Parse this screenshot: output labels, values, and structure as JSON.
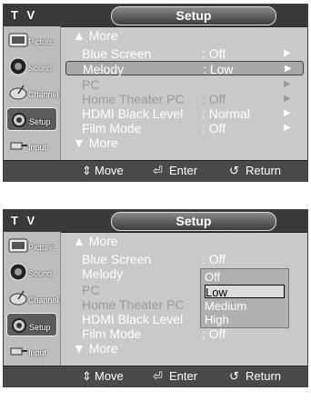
{
  "menu": {
    "tv_label": "T V",
    "title": "Setup",
    "nav": [
      {
        "label": "Picture"
      },
      {
        "label": "Sound"
      },
      {
        "label": "Channel"
      },
      {
        "label": "Setup"
      },
      {
        "label": "Input"
      }
    ],
    "more_up": "More",
    "more_down": "More",
    "footer": {
      "move": "Move",
      "enter": "Enter",
      "return": "Return"
    }
  },
  "screen1": {
    "rows": [
      {
        "label": "Blue Screen",
        "value": ": Off"
      },
      {
        "label": "Melody",
        "value": ": Low"
      },
      {
        "label": "PC",
        "value": ""
      },
      {
        "label": "Home Theater PC",
        "value": ": Off"
      },
      {
        "label": "HDMI Black Level",
        "value": ": Normal"
      },
      {
        "label": "Film Mode",
        "value": ": Off"
      }
    ]
  },
  "screen2": {
    "rows": [
      {
        "label": "Blue Screen",
        "value": ": Off"
      },
      {
        "label": "Melody",
        "value": ""
      },
      {
        "label": "PC",
        "value": ""
      },
      {
        "label": "Home Theater PC",
        "value": ""
      },
      {
        "label": "HDMI Black Level",
        "value": ""
      },
      {
        "label": "Film Mode",
        "value": ": Off"
      }
    ],
    "dropdown": [
      "Off",
      "Low",
      "Medium",
      "High"
    ]
  }
}
